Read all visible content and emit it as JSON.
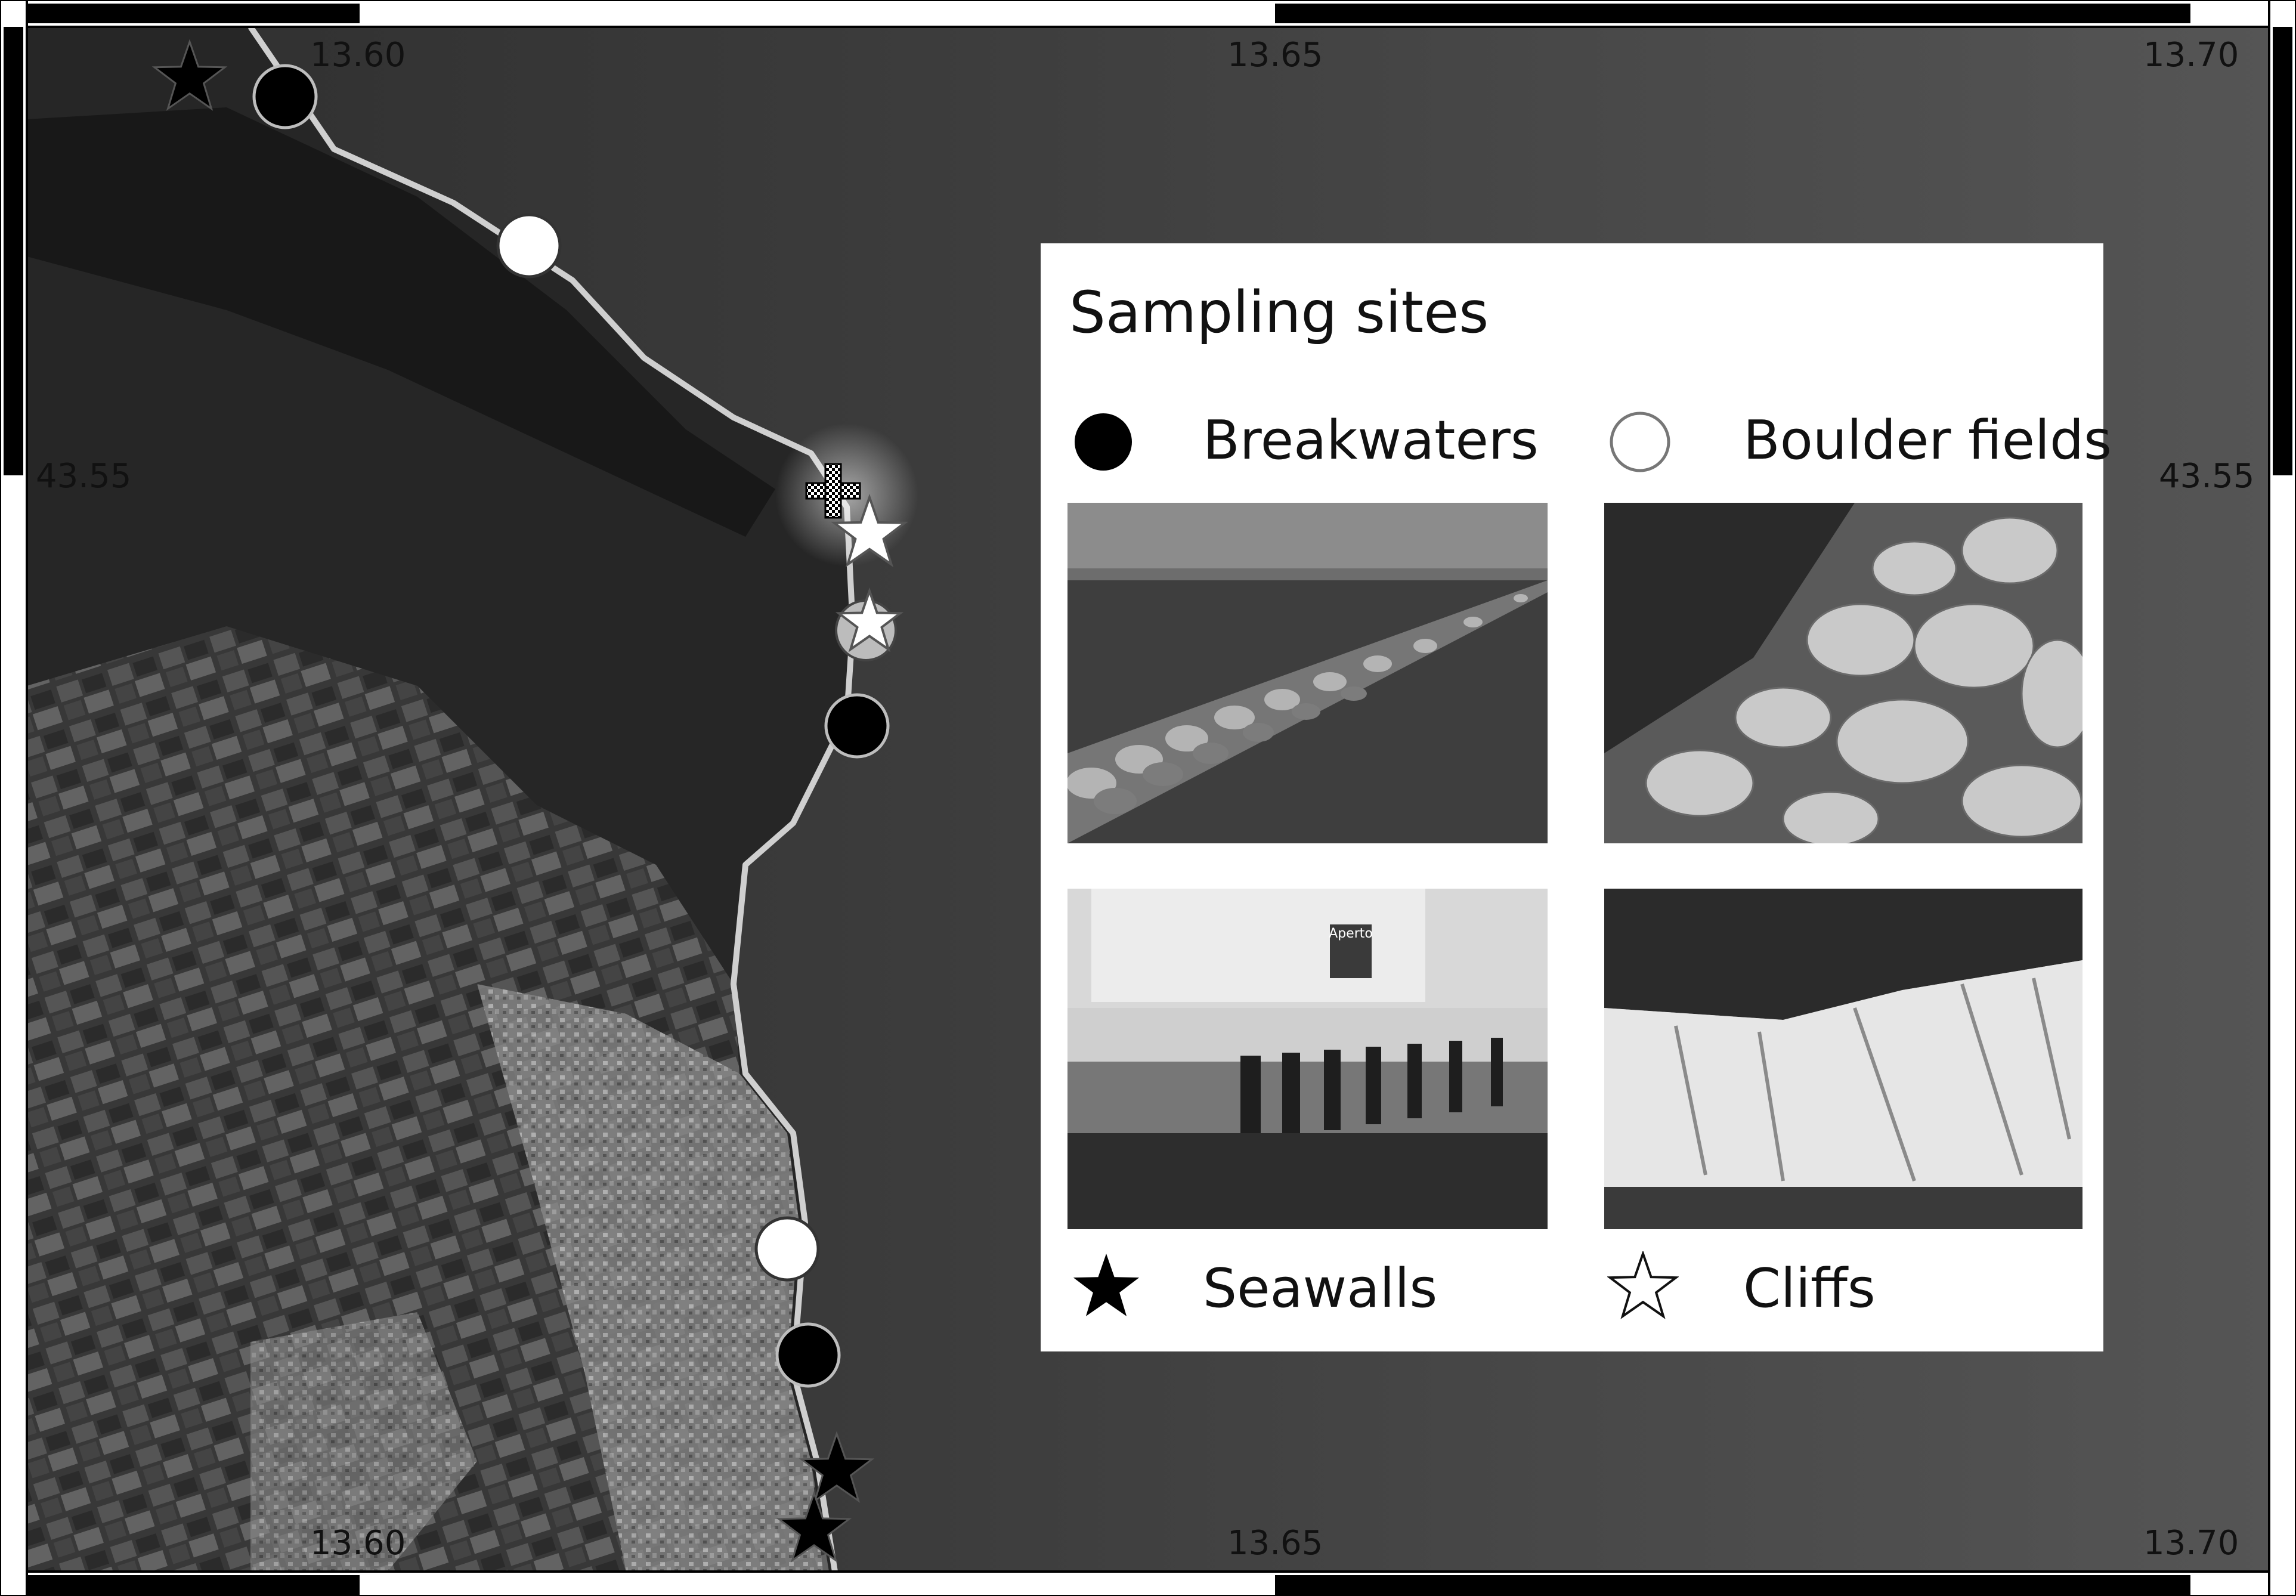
{
  "map": {
    "lon_ticks": [
      "13.60",
      "13.65",
      "13.70"
    ],
    "lat_ticks": [
      "43.55"
    ]
  },
  "legend": {
    "title": "Sampling sites",
    "breakwaters": "Breakwaters",
    "boulder_fields": "Boulder fields",
    "seawalls": "Seawalls",
    "cliffs": "Cliffs"
  },
  "photos": {
    "harbor_sign": "Aperto"
  },
  "colors": {
    "breakwaters": "#000000",
    "boulder_fields": "#ffffff",
    "seawalls": "#000000",
    "cliffs": "#ffffff",
    "sea": "#4a4a4a",
    "land": "#2a2a2a"
  }
}
